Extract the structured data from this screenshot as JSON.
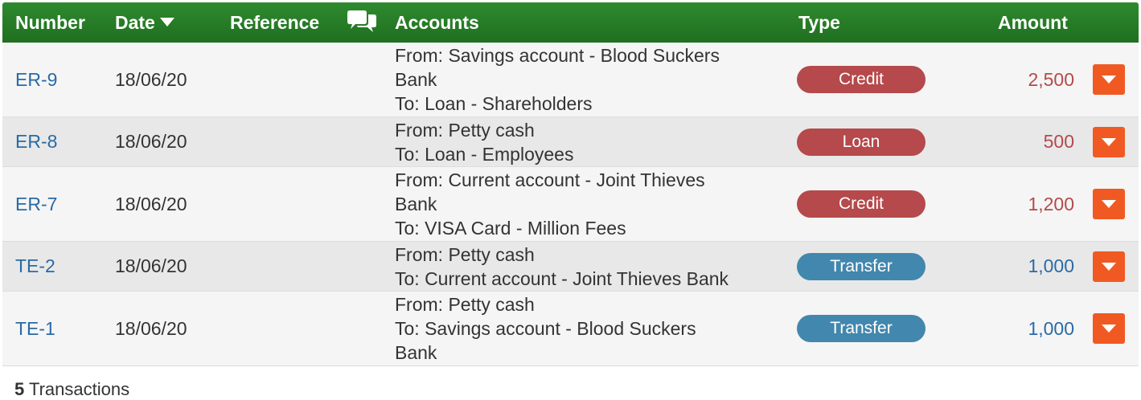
{
  "header": {
    "number": "Number",
    "date": "Date",
    "reference": "Reference",
    "accounts": "Accounts",
    "type": "Type",
    "amount": "Amount"
  },
  "colors": {
    "header_green": "#1f6f1f",
    "credit": "#b5494b",
    "transfer": "#4287ad",
    "menu_button": "#f05a22",
    "link_blue": "#2a6aa5"
  },
  "rows": [
    {
      "number": "ER-9",
      "date": "18/06/20",
      "accounts": [
        "From: Savings account - Blood Suckers",
        "Bank",
        "To: Loan - Shareholders"
      ],
      "type": "Credit",
      "type_color": "#b5494b",
      "amount": "2,500",
      "amount_color": "#b5494b"
    },
    {
      "number": "ER-8",
      "date": "18/06/20",
      "accounts": [
        "From: Petty cash",
        "To: Loan - Employees"
      ],
      "type": "Loan",
      "type_color": "#b5494b",
      "amount": "500",
      "amount_color": "#b5494b"
    },
    {
      "number": "ER-7",
      "date": "18/06/20",
      "accounts": [
        "From: Current account - Joint Thieves",
        "Bank",
        "To: VISA Card - Million Fees"
      ],
      "type": "Credit",
      "type_color": "#b5494b",
      "amount": "1,200",
      "amount_color": "#b5494b"
    },
    {
      "number": "TE-2",
      "date": "18/06/20",
      "accounts": [
        "From: Petty cash",
        "To: Current account - Joint Thieves Bank"
      ],
      "type": "Transfer",
      "type_color": "#4287ad",
      "amount": "1,000",
      "amount_color": "#2a6aa5"
    },
    {
      "number": "TE-1",
      "date": "18/06/20",
      "accounts": [
        "From: Petty cash",
        "To: Savings account - Blood Suckers",
        "Bank"
      ],
      "type": "Transfer",
      "type_color": "#4287ad",
      "amount": "1,000",
      "amount_color": "#2a6aa5"
    }
  ],
  "footer": {
    "count": "5",
    "label": "Transactions"
  },
  "icons": {
    "date_sort": "caret-down-icon",
    "reference": "speech-bubbles-icon",
    "row_menu": "caret-down-icon"
  }
}
